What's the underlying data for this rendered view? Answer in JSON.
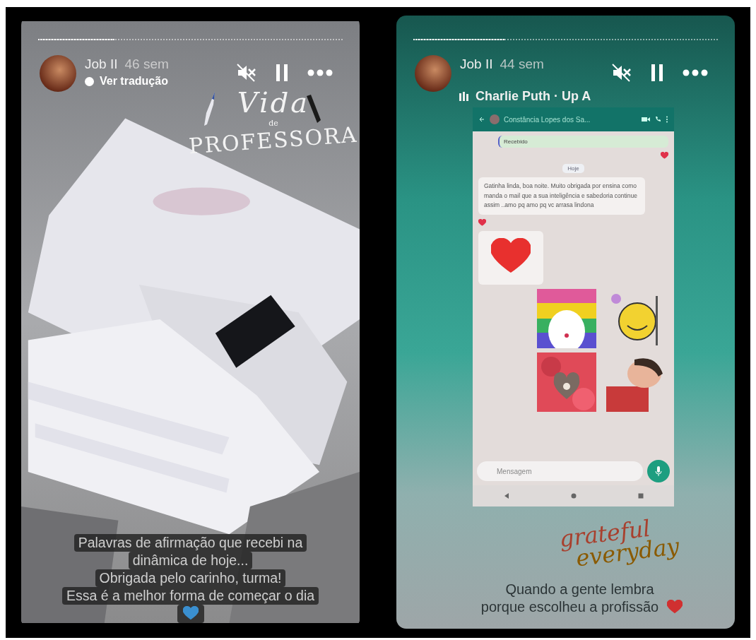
{
  "stories": [
    {
      "progress": {
        "level": 0.25
      },
      "user": "Job II",
      "age": "46 sem",
      "subtitle": "Ver tradução",
      "sticker": {
        "kind": "vida",
        "lines": [
          "Vida",
          "de",
          "PROFESSORA"
        ]
      },
      "caption": {
        "lines": [
          "Palavras de afirmação que recebi na",
          "dinâmica de hoje...",
          "Obrigada pelo carinho, turma!",
          "Essa é a melhor forma de começar o dia"
        ],
        "color": "#3a8fd0"
      }
    },
    {
      "kind": "chat",
      "progress": {
        "level": 0.3
      },
      "user": "Job II",
      "age": "44 sem",
      "music": "Charlie Puth · Up A",
      "chat": {
        "contact": "Constância Lopes dos Sa...",
        "placeholder": "Mensagem",
        "messages": [
          {
            "kind": "reply",
            "text": "Recebido",
            "reaction": true
          },
          {
            "kind": "date",
            "text": "Hoje"
          },
          {
            "kind": "text",
            "text": "Gatinha linda, boa noite. Muito obrigada por ensina como manda o mail que a sua inteligência e sabedoria continue assim ..amo pq amo pq vc arrasa lindona",
            "reaction": true
          },
          {
            "kind": "heart"
          },
          {
            "kind": "stickers"
          },
          {
            "kind": "stickers"
          }
        ]
      },
      "sticker": {
        "kind": "grateful",
        "lines": [
          "grateful",
          "everyday"
        ]
      },
      "caption": {
        "lines": [
          "Quando a gente lembra",
          "porque escolheu a profissão"
        ],
        "color": "#d03030"
      }
    }
  ]
}
